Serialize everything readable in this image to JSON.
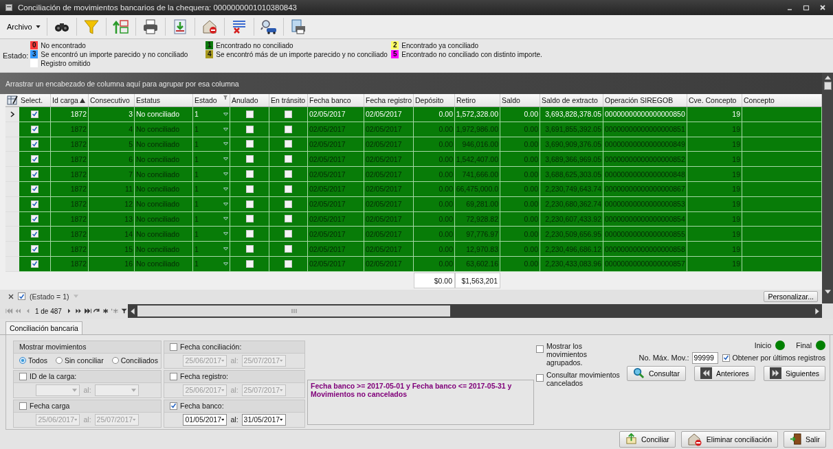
{
  "window": {
    "title": "Conciliación de movimientos bancarios de la chequera: 0000000001010380843"
  },
  "toolbar": {
    "menu": "Archivo"
  },
  "legend": {
    "label": "Estado:",
    "items": [
      {
        "code": "0",
        "label": "No encontrado",
        "color": "#ff3b3b"
      },
      {
        "code": "1",
        "label": "Encontrado no conciliado",
        "color": "#0a7a0a"
      },
      {
        "code": "2",
        "label": "Encontrado ya conciliado",
        "color": "#ffff66"
      },
      {
        "code": "3",
        "label": "Se encontró un importe parecido y no conciliado",
        "color": "#3399ff"
      },
      {
        "code": "4",
        "label": "Se encontró más de un importe parecido y no conciliado",
        "color": "#a89a1e"
      },
      {
        "code": "5",
        "label": "Encontrado no conciliado con distinto importe.",
        "color": "#ff00ff"
      },
      {
        "label": "Registro omitido",
        "color": "#ffffff"
      }
    ]
  },
  "group_panel": {
    "hint": "Arrastrar un encabezado de columna aquí para agrupar por esa columna"
  },
  "grid": {
    "columns": [
      {
        "label": "Select.",
        "sorted": false,
        "filtered": false
      },
      {
        "label": "Id carga",
        "sorted": true,
        "filtered": false
      },
      {
        "label": "Consecutivo",
        "sorted": false,
        "filtered": false
      },
      {
        "label": "Estatus",
        "sorted": false,
        "filtered": false
      },
      {
        "label": "Estado",
        "sorted": false,
        "filtered": true
      },
      {
        "label": "Anulado",
        "sorted": false,
        "filtered": false
      },
      {
        "label": "En tránsito",
        "sorted": false,
        "filtered": false
      },
      {
        "label": "Fecha banco",
        "sorted": false,
        "filtered": false
      },
      {
        "label": "Fecha registro",
        "sorted": false,
        "filtered": false
      },
      {
        "label": "Depósito",
        "sorted": false,
        "filtered": false
      },
      {
        "label": "Retiro",
        "sorted": false,
        "filtered": false
      },
      {
        "label": "Saldo",
        "sorted": false,
        "filtered": false
      },
      {
        "label": "Saldo de extracto",
        "sorted": false,
        "filtered": false
      },
      {
        "label": "Operación SIREGOB",
        "sorted": false,
        "filtered": false
      },
      {
        "label": "Cve. Concepto",
        "sorted": false,
        "filtered": false
      },
      {
        "label": "Concepto",
        "sorted": false,
        "filtered": false
      }
    ],
    "rows": [
      {
        "selected": true,
        "checked": true,
        "id_carga": "1872",
        "consecutivo": "3",
        "estatus": "No conciliado",
        "estado": "1",
        "anulado": false,
        "en_transito": false,
        "fecha_banco": "02/05/2017",
        "fecha_registro": "02/05/2017",
        "deposito": "0.00",
        "retiro": "1,572,328.00",
        "saldo": "0.00",
        "saldo_extracto": "3,693,828,378.05",
        "operacion": "00000000000000000850",
        "cve_concepto": "19"
      },
      {
        "selected": false,
        "checked": true,
        "id_carga": "1872",
        "consecutivo": "4",
        "estatus": "No conciliado",
        "estado": "1",
        "anulado": false,
        "en_transito": false,
        "fecha_banco": "02/05/2017",
        "fecha_registro": "02/05/2017",
        "deposito": "0.00",
        "retiro": "1,972,986.00",
        "saldo": "0.00",
        "saldo_extracto": "3,691,855,392.05",
        "operacion": "00000000000000000851",
        "cve_concepto": "19"
      },
      {
        "selected": false,
        "checked": true,
        "id_carga": "1872",
        "consecutivo": "5",
        "estatus": "No conciliado",
        "estado": "1",
        "anulado": false,
        "en_transito": false,
        "fecha_banco": "02/05/2017",
        "fecha_registro": "02/05/2017",
        "deposito": "0.00",
        "retiro": "946,016.00",
        "saldo": "0.00",
        "saldo_extracto": "3,690,909,376.05",
        "operacion": "00000000000000000849",
        "cve_concepto": "19"
      },
      {
        "selected": false,
        "checked": true,
        "id_carga": "1872",
        "consecutivo": "6",
        "estatus": "No conciliado",
        "estado": "1",
        "anulado": false,
        "en_transito": false,
        "fecha_banco": "02/05/2017",
        "fecha_registro": "02/05/2017",
        "deposito": "0.00",
        "retiro": "1,542,407.00",
        "saldo": "0.00",
        "saldo_extracto": "3,689,366,969.05",
        "operacion": "00000000000000000852",
        "cve_concepto": "19"
      },
      {
        "selected": false,
        "checked": true,
        "id_carga": "1872",
        "consecutivo": "7",
        "estatus": "No conciliado",
        "estado": "1",
        "anulado": false,
        "en_transito": false,
        "fecha_banco": "02/05/2017",
        "fecha_registro": "02/05/2017",
        "deposito": "0.00",
        "retiro": "741,666.00",
        "saldo": "0.00",
        "saldo_extracto": "3,688,625,303.05",
        "operacion": "00000000000000000848",
        "cve_concepto": "19"
      },
      {
        "selected": false,
        "checked": true,
        "id_carga": "1872",
        "consecutivo": "11",
        "estatus": "No conciliado",
        "estado": "1",
        "anulado": false,
        "en_transito": false,
        "fecha_banco": "02/05/2017",
        "fecha_registro": "02/05/2017",
        "deposito": "0.00",
        "retiro": "66,475,000.0",
        "saldo": "0.00",
        "saldo_extracto": "2,230,749,643.74",
        "operacion": "00000000000000000867",
        "cve_concepto": "19"
      },
      {
        "selected": false,
        "checked": true,
        "id_carga": "1872",
        "consecutivo": "12",
        "estatus": "No conciliado",
        "estado": "1",
        "anulado": false,
        "en_transito": false,
        "fecha_banco": "02/05/2017",
        "fecha_registro": "02/05/2017",
        "deposito": "0.00",
        "retiro": "69,281.00",
        "saldo": "0.00",
        "saldo_extracto": "2,230,680,362.74",
        "operacion": "00000000000000000853",
        "cve_concepto": "19"
      },
      {
        "selected": false,
        "checked": true,
        "id_carga": "1872",
        "consecutivo": "13",
        "estatus": "No conciliado",
        "estado": "1",
        "anulado": false,
        "en_transito": false,
        "fecha_banco": "02/05/2017",
        "fecha_registro": "02/05/2017",
        "deposito": "0.00",
        "retiro": "72,928.82",
        "saldo": "0.00",
        "saldo_extracto": "2,230,607,433.92",
        "operacion": "00000000000000000854",
        "cve_concepto": "19"
      },
      {
        "selected": false,
        "checked": true,
        "id_carga": "1872",
        "consecutivo": "14",
        "estatus": "No conciliado",
        "estado": "1",
        "anulado": false,
        "en_transito": false,
        "fecha_banco": "02/05/2017",
        "fecha_registro": "02/05/2017",
        "deposito": "0.00",
        "retiro": "97,776.97",
        "saldo": "0.00",
        "saldo_extracto": "2,230,509,656.95",
        "operacion": "00000000000000000855",
        "cve_concepto": "19"
      },
      {
        "selected": false,
        "checked": true,
        "id_carga": "1872",
        "consecutivo": "15",
        "estatus": "No conciliado",
        "estado": "1",
        "anulado": false,
        "en_transito": false,
        "fecha_banco": "02/05/2017",
        "fecha_registro": "02/05/2017",
        "deposito": "0.00",
        "retiro": "12,970.83",
        "saldo": "0.00",
        "saldo_extracto": "2,230,496,686.12",
        "operacion": "00000000000000000858",
        "cve_concepto": "19"
      },
      {
        "selected": false,
        "checked": true,
        "id_carga": "1872",
        "consecutivo": "16",
        "estatus": "No conciliado",
        "estado": "1",
        "anulado": false,
        "en_transito": false,
        "fecha_banco": "02/05/2017",
        "fecha_registro": "02/05/2017",
        "deposito": "0.00",
        "retiro": "63,602.16",
        "saldo": "0.00",
        "saldo_extracto": "2,230,433,083.96",
        "operacion": "00000000000000000857",
        "cve_concepto": "19"
      }
    ],
    "summary": {
      "deposito": "$0.00",
      "retiro": "$1,563,201"
    }
  },
  "filter": {
    "enabled": true,
    "text": "(Estado = 1)",
    "customize": "Personalizar..."
  },
  "pager": {
    "text": "1 de 487"
  },
  "tabs": [
    {
      "label": "Conciliación bancaria",
      "selected": true
    }
  ],
  "panel": {
    "show_movements": {
      "title": "Mostrar movimientos",
      "options": [
        {
          "label": "Todos",
          "selected": true
        },
        {
          "label": "Sin conciliar",
          "selected": false
        },
        {
          "label": "Conciliados",
          "selected": false
        }
      ]
    },
    "left_ranges": [
      {
        "label": "ID de la carga:",
        "checked": false,
        "separator": "al:"
      },
      {
        "label": "Fecha carga",
        "checked": false,
        "from": "25/06/2017",
        "separator": "al:",
        "to": "25/07/2017"
      }
    ],
    "right_ranges": [
      {
        "label": "Fecha conciliación:",
        "checked": false,
        "from": "25/06/2017",
        "separator": "al:",
        "to": "25/07/2017"
      },
      {
        "label": "Fecha registro:",
        "checked": false,
        "from": "25/06/2017",
        "separator": "al:",
        "to": "25/07/2017"
      },
      {
        "label": "Fecha banco:",
        "checked": true,
        "from": "01/05/2017",
        "separator": "al:",
        "to": "31/05/2017"
      }
    ],
    "query_text": "Fecha banco >= 2017-05-01  y Fecha banco <= 2017-05-31 y  Movimientos no cancelados",
    "options": [
      {
        "label": "Mostrar los movimientos agrupados.",
        "checked": false
      },
      {
        "label": "Consultar movimientos cancelados",
        "checked": false
      }
    ],
    "indicators": [
      {
        "label": "Inicio",
        "color": "#008000"
      },
      {
        "label": "Final",
        "color": "#008000"
      }
    ],
    "max_movements": {
      "label": "No. Máx. Mov.:",
      "value": "99999"
    },
    "latest": {
      "label": "Obtener por últimos registros",
      "checked": true
    },
    "buttons": [
      {
        "label": "Consultar",
        "kind": "search"
      },
      {
        "label": "Anteriores",
        "kind": "previous"
      },
      {
        "label": "Siguientes",
        "kind": "next"
      }
    ]
  },
  "footer_buttons": [
    {
      "label": "Conciliar",
      "kind": "reconcile"
    },
    {
      "label": "Eliminar conciliación",
      "kind": "delete"
    },
    {
      "label": "Salir",
      "kind": "exit"
    }
  ]
}
